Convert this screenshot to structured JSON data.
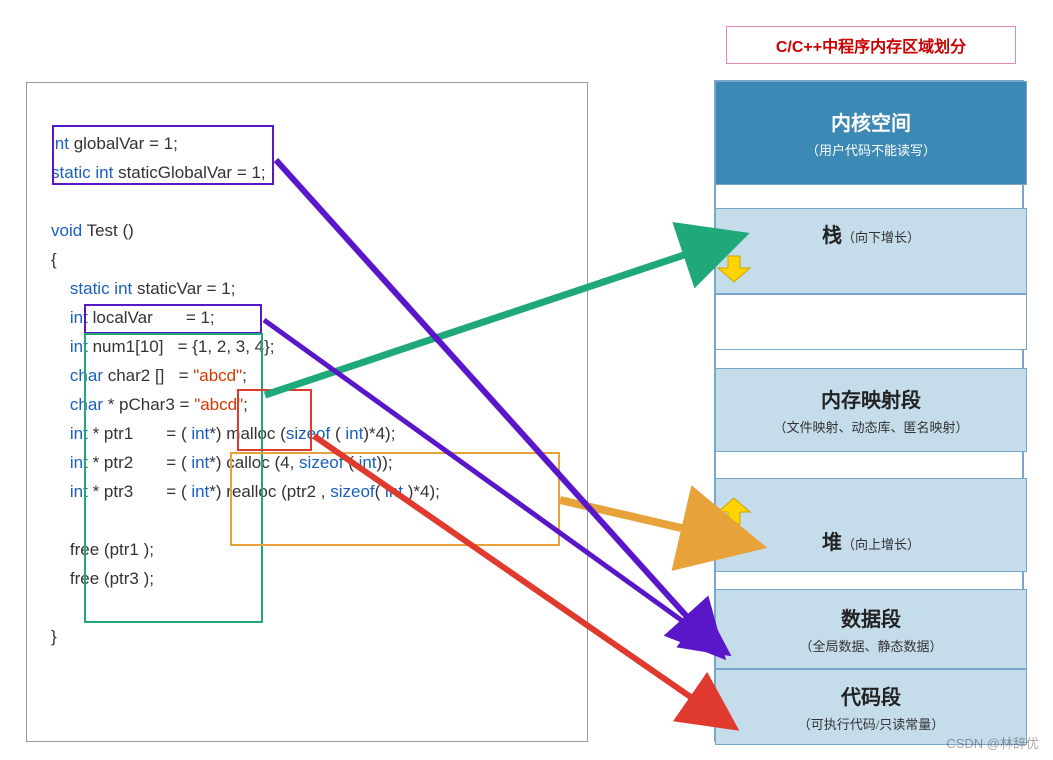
{
  "title": "C/C++中程序内存区域划分",
  "code": {
    "l1a": "int",
    "l1b": " globalVar",
    "l1c": " = 1;",
    "l2a": "static int",
    "l2b": " staticGlobalVar",
    "l2c": " = 1;",
    "l3a": "void",
    "l3b": " Test ()",
    "l4": "{",
    "l5a": "static int",
    "l5b": " staticVar",
    "l5c": " = 1;",
    "l6a": "int",
    "l6b": " localVar",
    "l6c": "       = 1;",
    "l7a": "int",
    "l7b": " num1[10]   = {1, 2, 3, 4};",
    "l8a": "char",
    "l8b": " char2 []   = ",
    "l8c": "\"abcd\"",
    "l8d": ";",
    "l9a": "char",
    "l9b": " * pChar3 = ",
    "l9c": "\"abcd\"",
    "l9d": ";",
    "l10a": "int",
    "l10b": " * ptr1       = ( ",
    "l10c": "int",
    "l10d": "*) malloc (",
    "l10e": "sizeof",
    "l10f": " ( ",
    "l10g": "int",
    "l10h": ")*4);",
    "l11a": "int",
    "l11b": " * ptr2       = ( ",
    "l11c": "int",
    "l11d": "*) calloc (4, ",
    "l11e": "sizeof",
    "l11f": " ( ",
    "l11g": "int",
    "l11h": "));",
    "l12a": "int",
    "l12b": " * ptr3       = ( ",
    "l12c": "int",
    "l12d": "*) realloc (ptr2 , ",
    "l12e": "sizeof",
    "l12f": "( ",
    "l12g": "int",
    "l12h": " )*4);",
    "l13": "free (ptr1 );",
    "l14": "free (ptr3 );",
    "l15": "}"
  },
  "regions": {
    "kernel": {
      "title": "内核空间",
      "sub": "（用户代码不能读写）"
    },
    "stack": {
      "title": "栈",
      "sub": "（向下增长）"
    },
    "mmap": {
      "title": "内存映射段",
      "sub": "（文件映射、动态库、匿名映射）"
    },
    "heap": {
      "title": "堆",
      "sub": "（向上增长）"
    },
    "data": {
      "title": "数据段",
      "sub": "（全局数据、静态数据）"
    },
    "code": {
      "title": "代码段",
      "sub": "（可执行代码/只读常量）"
    }
  },
  "arrows": {
    "green": {
      "from": "local/auto variables",
      "to": "stack"
    },
    "orange": {
      "from": "malloc/calloc/realloc",
      "to": "heap"
    },
    "purple": {
      "from": "global/static variables",
      "to": "data"
    },
    "red": {
      "from": "string literals",
      "to": "code"
    }
  },
  "colors": {
    "kernel": "#3d89b6",
    "region": "#c5dceb",
    "arrow_green": "#1fa87a",
    "arrow_orange": "#e8a23a",
    "arrow_purple": "#5a17c9",
    "arrow_red": "#e03a2f",
    "yellow_arrow": "#ffd400"
  },
  "watermark": "CSDN @林辞优"
}
